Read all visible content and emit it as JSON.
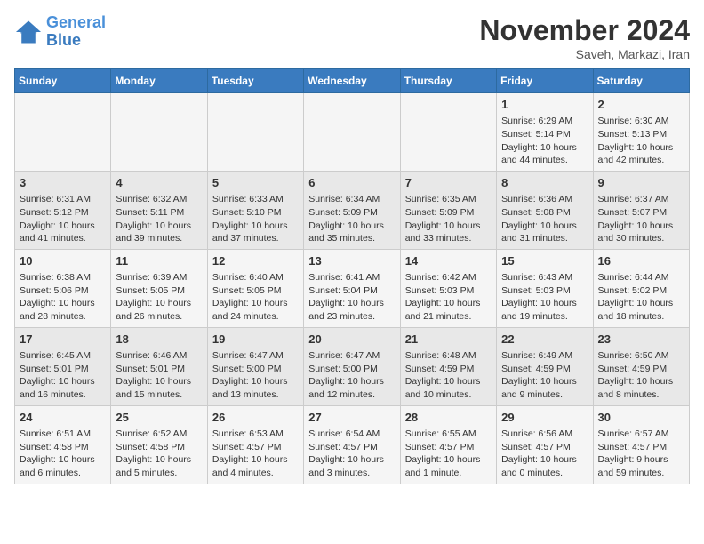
{
  "header": {
    "logo_line1": "General",
    "logo_line2": "Blue",
    "month": "November 2024",
    "location": "Saveh, Markazi, Iran"
  },
  "weekdays": [
    "Sunday",
    "Monday",
    "Tuesday",
    "Wednesday",
    "Thursday",
    "Friday",
    "Saturday"
  ],
  "weeks": [
    [
      {
        "day": "",
        "content": ""
      },
      {
        "day": "",
        "content": ""
      },
      {
        "day": "",
        "content": ""
      },
      {
        "day": "",
        "content": ""
      },
      {
        "day": "",
        "content": ""
      },
      {
        "day": "1",
        "content": "Sunrise: 6:29 AM\nSunset: 5:14 PM\nDaylight: 10 hours and 44 minutes."
      },
      {
        "day": "2",
        "content": "Sunrise: 6:30 AM\nSunset: 5:13 PM\nDaylight: 10 hours and 42 minutes."
      }
    ],
    [
      {
        "day": "3",
        "content": "Sunrise: 6:31 AM\nSunset: 5:12 PM\nDaylight: 10 hours and 41 minutes."
      },
      {
        "day": "4",
        "content": "Sunrise: 6:32 AM\nSunset: 5:11 PM\nDaylight: 10 hours and 39 minutes."
      },
      {
        "day": "5",
        "content": "Sunrise: 6:33 AM\nSunset: 5:10 PM\nDaylight: 10 hours and 37 minutes."
      },
      {
        "day": "6",
        "content": "Sunrise: 6:34 AM\nSunset: 5:09 PM\nDaylight: 10 hours and 35 minutes."
      },
      {
        "day": "7",
        "content": "Sunrise: 6:35 AM\nSunset: 5:09 PM\nDaylight: 10 hours and 33 minutes."
      },
      {
        "day": "8",
        "content": "Sunrise: 6:36 AM\nSunset: 5:08 PM\nDaylight: 10 hours and 31 minutes."
      },
      {
        "day": "9",
        "content": "Sunrise: 6:37 AM\nSunset: 5:07 PM\nDaylight: 10 hours and 30 minutes."
      }
    ],
    [
      {
        "day": "10",
        "content": "Sunrise: 6:38 AM\nSunset: 5:06 PM\nDaylight: 10 hours and 28 minutes."
      },
      {
        "day": "11",
        "content": "Sunrise: 6:39 AM\nSunset: 5:05 PM\nDaylight: 10 hours and 26 minutes."
      },
      {
        "day": "12",
        "content": "Sunrise: 6:40 AM\nSunset: 5:05 PM\nDaylight: 10 hours and 24 minutes."
      },
      {
        "day": "13",
        "content": "Sunrise: 6:41 AM\nSunset: 5:04 PM\nDaylight: 10 hours and 23 minutes."
      },
      {
        "day": "14",
        "content": "Sunrise: 6:42 AM\nSunset: 5:03 PM\nDaylight: 10 hours and 21 minutes."
      },
      {
        "day": "15",
        "content": "Sunrise: 6:43 AM\nSunset: 5:03 PM\nDaylight: 10 hours and 19 minutes."
      },
      {
        "day": "16",
        "content": "Sunrise: 6:44 AM\nSunset: 5:02 PM\nDaylight: 10 hours and 18 minutes."
      }
    ],
    [
      {
        "day": "17",
        "content": "Sunrise: 6:45 AM\nSunset: 5:01 PM\nDaylight: 10 hours and 16 minutes."
      },
      {
        "day": "18",
        "content": "Sunrise: 6:46 AM\nSunset: 5:01 PM\nDaylight: 10 hours and 15 minutes."
      },
      {
        "day": "19",
        "content": "Sunrise: 6:47 AM\nSunset: 5:00 PM\nDaylight: 10 hours and 13 minutes."
      },
      {
        "day": "20",
        "content": "Sunrise: 6:47 AM\nSunset: 5:00 PM\nDaylight: 10 hours and 12 minutes."
      },
      {
        "day": "21",
        "content": "Sunrise: 6:48 AM\nSunset: 4:59 PM\nDaylight: 10 hours and 10 minutes."
      },
      {
        "day": "22",
        "content": "Sunrise: 6:49 AM\nSunset: 4:59 PM\nDaylight: 10 hours and 9 minutes."
      },
      {
        "day": "23",
        "content": "Sunrise: 6:50 AM\nSunset: 4:59 PM\nDaylight: 10 hours and 8 minutes."
      }
    ],
    [
      {
        "day": "24",
        "content": "Sunrise: 6:51 AM\nSunset: 4:58 PM\nDaylight: 10 hours and 6 minutes."
      },
      {
        "day": "25",
        "content": "Sunrise: 6:52 AM\nSunset: 4:58 PM\nDaylight: 10 hours and 5 minutes."
      },
      {
        "day": "26",
        "content": "Sunrise: 6:53 AM\nSunset: 4:57 PM\nDaylight: 10 hours and 4 minutes."
      },
      {
        "day": "27",
        "content": "Sunrise: 6:54 AM\nSunset: 4:57 PM\nDaylight: 10 hours and 3 minutes."
      },
      {
        "day": "28",
        "content": "Sunrise: 6:55 AM\nSunset: 4:57 PM\nDaylight: 10 hours and 1 minute."
      },
      {
        "day": "29",
        "content": "Sunrise: 6:56 AM\nSunset: 4:57 PM\nDaylight: 10 hours and 0 minutes."
      },
      {
        "day": "30",
        "content": "Sunrise: 6:57 AM\nSunset: 4:57 PM\nDaylight: 9 hours and 59 minutes."
      }
    ]
  ]
}
